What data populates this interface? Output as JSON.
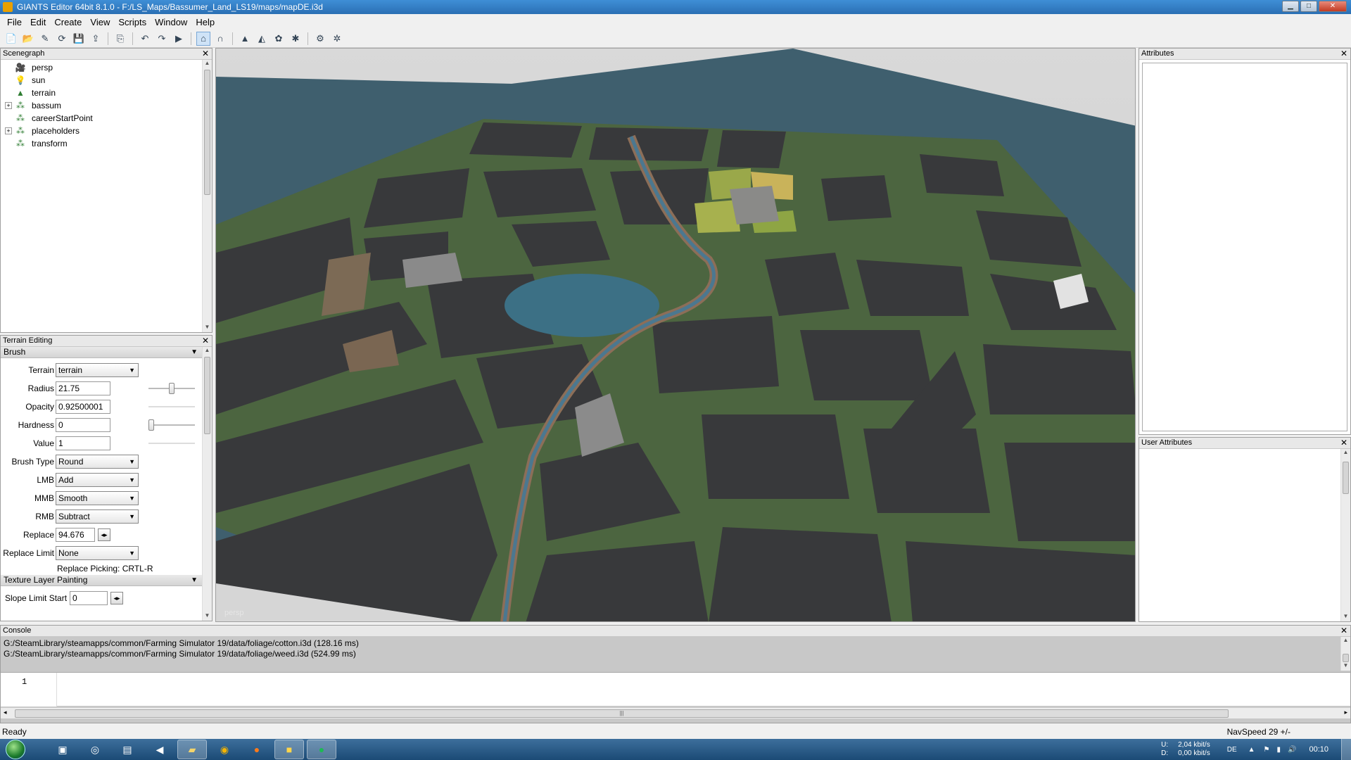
{
  "window": {
    "title": "GIANTS Editor 64bit 8.1.0 - F:/LS_Maps/Bassumer_Land_LS19/maps/mapDE.i3d",
    "min": "▁",
    "max": "□",
    "close": "✕"
  },
  "menu": [
    "File",
    "Edit",
    "Create",
    "View",
    "Scripts",
    "Window",
    "Help"
  ],
  "toolbar_icons": [
    "new-file-icon",
    "open-icon",
    "edit-icon",
    "reload-icon",
    "save-icon",
    "export-icon",
    "import-icon",
    "undo-icon",
    "redo-icon",
    "play-icon",
    "select-tool-icon",
    "move-tool-icon",
    "terrain-paint-icon",
    "terrain-sculpt-icon",
    "foliage-paint-icon",
    "decal-paint-icon",
    "settings-icon",
    "gear-icon"
  ],
  "scenegraph": {
    "title": "Scenegraph",
    "items": [
      {
        "label": "persp",
        "icon": "camera-icon",
        "expandable": false
      },
      {
        "label": "sun",
        "icon": "light-icon",
        "expandable": false
      },
      {
        "label": "terrain",
        "icon": "terrain-icon",
        "expandable": false
      },
      {
        "label": "bassum",
        "icon": "transform-group-icon",
        "expandable": true
      },
      {
        "label": "careerStartPoint",
        "icon": "transform-group-icon",
        "expandable": false
      },
      {
        "label": "placeholders",
        "icon": "transform-group-icon",
        "expandable": true
      },
      {
        "label": "transform",
        "icon": "transform-group-icon",
        "expandable": false
      }
    ]
  },
  "terrain_editing": {
    "title": "Terrain Editing",
    "brush_section": "Brush",
    "terrain_label": "Terrain",
    "terrain_value": "terrain",
    "radius_label": "Radius",
    "radius_value": "21.75",
    "radius_slider": 0.5,
    "opacity_label": "Opacity",
    "opacity_value": "0.92500001",
    "hardness_label": "Hardness",
    "hardness_value": "0",
    "hardness_slider": 0.0,
    "value_label": "Value",
    "value_value": "1",
    "brush_type_label": "Brush Type",
    "brush_type_value": "Round",
    "lmb_label": "LMB",
    "lmb_value": "Add",
    "mmb_label": "MMB",
    "mmb_value": "Smooth",
    "rmb_label": "RMB",
    "rmb_value": "Subtract",
    "replace_label": "Replace",
    "replace_value": "94.676",
    "replace_limit_label": "Replace Limit",
    "replace_limit_value": "None",
    "replace_picking": "Replace Picking: CRTL-R",
    "texture_section": "Texture Layer Painting",
    "slope_start_label": "Slope Limit Start",
    "slope_start_value": "0"
  },
  "viewport": {
    "camera_label": "persp"
  },
  "attributes": {
    "title": "Attributes"
  },
  "user_attributes": {
    "title": "User Attributes"
  },
  "console": {
    "title": "Console",
    "lines": [
      "G:/SteamLibrary/steamapps/common/Farming Simulator 19/data/foliage/cotton.i3d (128.16 ms)",
      "G:/SteamLibrary/steamapps/common/Farming Simulator 19/data/foliage/weed.i3d (524.99 ms)"
    ],
    "line_number": "1"
  },
  "status": {
    "left": "Ready",
    "right": "NavSpeed 29 +/-"
  },
  "taskbar": {
    "apps": [
      "giants-editor-icon",
      "steam-icon",
      "notepad-icon",
      "media-icon",
      "explorer-icon",
      "outlook-icon",
      "firefox-icon",
      "sticky-notes-icon",
      "spotify-icon"
    ],
    "upload_label": "U:",
    "upload_value": "2,04 kbit/s",
    "download_label": "D:",
    "download_value": "0,00 kbit/s",
    "lang": "DE",
    "clock": "00:10"
  },
  "colors": {
    "titlebar": "#2a6fb4",
    "water": "#3f5f6e",
    "field": "#3a3b3d",
    "grass": "#4f6a3f"
  }
}
